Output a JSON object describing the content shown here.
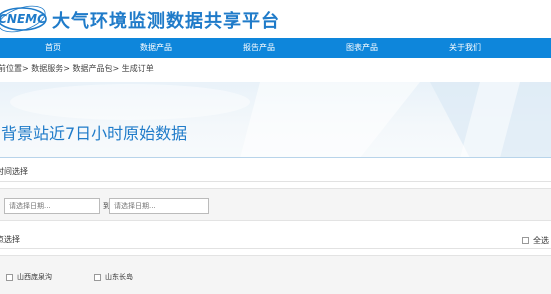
{
  "header": {
    "logo_text": "CNEMC",
    "site_title": "大气环境监测数据共享平台"
  },
  "nav": {
    "items": [
      {
        "label": "首页"
      },
      {
        "label": "数据产品"
      },
      {
        "label": "报告产品"
      },
      {
        "label": "图表产品"
      },
      {
        "label": "关于我们"
      }
    ]
  },
  "breadcrumb": {
    "text": "前位置> 数据服务> 数据产品包> 生成订单"
  },
  "banner": {
    "title": "背景站近7日小时原始数据"
  },
  "time_section": {
    "label": "时间选择",
    "start_placeholder": "请选择日期...",
    "separator": "到",
    "end_placeholder": "请选择日期..."
  },
  "station_section": {
    "label": "点选择",
    "select_all_label": "全选",
    "stations": [
      {
        "label": "山西庞泉沟",
        "checked": false
      },
      {
        "label": "山东长岛",
        "checked": false
      }
    ]
  },
  "colors": {
    "brand_blue": "#1f7bc9",
    "nav_bg": "#0e86db"
  }
}
